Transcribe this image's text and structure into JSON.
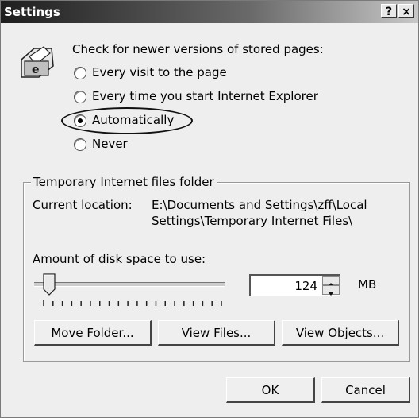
{
  "window": {
    "title": "Settings",
    "help_label": "?",
    "close_label": "×"
  },
  "check_prompt": "Check for newer versions of stored pages:",
  "options": [
    {
      "label": "Every visit to the page",
      "selected": false
    },
    {
      "label": "Every time you start Internet Explorer",
      "selected": false
    },
    {
      "label": "Automatically",
      "selected": true
    },
    {
      "label": "Never",
      "selected": false
    }
  ],
  "temp_folder": {
    "group_title": "Temporary Internet files folder",
    "location_label": "Current location:",
    "location_line1": "E:\\Documents and Settings\\zff\\Local",
    "location_line2": "Settings\\Temporary Internet Files\\",
    "disk_label": "Amount of disk space to use:",
    "disk_value": "124",
    "unit": "MB",
    "slider_level": 0.05
  },
  "buttons": {
    "move_folder": "Move Folder...",
    "view_files": "View Files...",
    "view_objects": "View Objects...",
    "ok": "OK",
    "cancel": "Cancel"
  },
  "icons": {
    "dialog_icon": "ie-page-icon",
    "help": "help-icon",
    "close": "close-icon"
  }
}
